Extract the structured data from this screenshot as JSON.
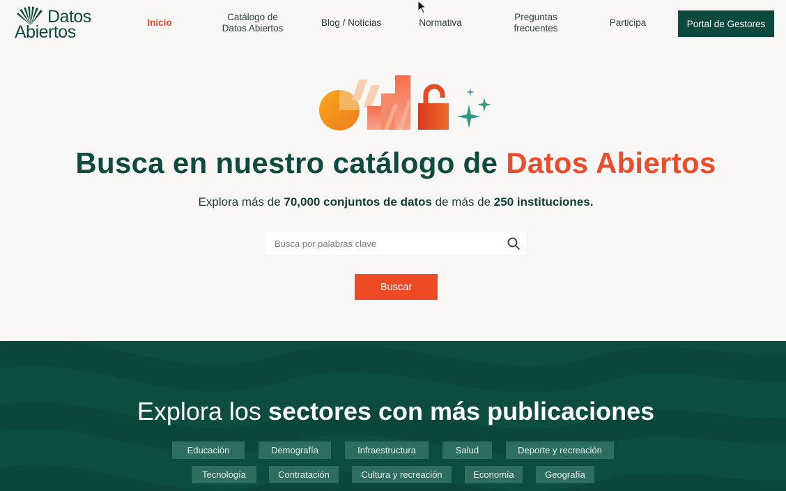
{
  "logo": {
    "line1": "Datos",
    "line2": "Abiertos"
  },
  "nav": {
    "items": [
      {
        "label": "Inicio"
      },
      {
        "line1": "Catálogo de",
        "line2": "Datos Abiertos"
      },
      {
        "label": "Blog / Noticias"
      },
      {
        "label": "Normativa"
      },
      {
        "line1": "Preguntas",
        "line2": "frecuentes"
      },
      {
        "label": "Participa"
      }
    ],
    "portal_label": "Portal de Gestores"
  },
  "hero": {
    "title_part1": "Busca en nuestro catálogo de ",
    "title_accent": "Datos Abiertos",
    "sub_part1": "Explora más de ",
    "sub_bold1": "70,000 conjuntos de datos",
    "sub_part2": " de más de ",
    "sub_bold2": "250 instituciones."
  },
  "search": {
    "placeholder": "Busca por palabras clave",
    "value": "",
    "button_label": "Buscar"
  },
  "sectors": {
    "title_light": "Explora los ",
    "title_bold": "sectores con más publicaciones",
    "row1": [
      "Educación",
      "Demografía",
      "Infraestructura",
      "Salud",
      "Deporte y recreación"
    ],
    "row2": [
      "Tecnología",
      "Contratación",
      "Cultura y recreación",
      "Economía",
      "Geografía"
    ]
  },
  "colors": {
    "brand_green": "#0c4a3e",
    "accent_orange": "#ea4c2c",
    "chip_green": "#2e6e60"
  }
}
